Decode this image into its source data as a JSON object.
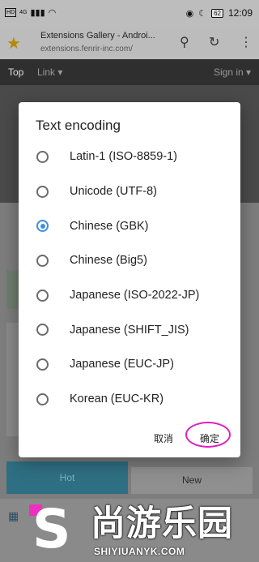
{
  "status_bar": {
    "left_badge": "HD",
    "signal_label": "4G",
    "battery": "62",
    "time": "12:09"
  },
  "browser": {
    "page_title": "Extensions Gallery - Androi...",
    "url": "extensions.fenrir-inc.com/"
  },
  "site_nav": {
    "top": "Top",
    "link": "Link ▾",
    "signin": "Sign in ▾"
  },
  "tabs": {
    "hot": "Hot",
    "new": "New"
  },
  "dialog": {
    "title": "Text encoding",
    "options": [
      {
        "label": "Latin-1 (ISO-8859-1)",
        "selected": false
      },
      {
        "label": "Unicode (UTF-8)",
        "selected": false
      },
      {
        "label": "Chinese (GBK)",
        "selected": true
      },
      {
        "label": "Chinese (Big5)",
        "selected": false
      },
      {
        "label": "Japanese (ISO-2022-JP)",
        "selected": false
      },
      {
        "label": "Japanese (SHIFT_JIS)",
        "selected": false
      },
      {
        "label": "Japanese (EUC-JP)",
        "selected": false
      },
      {
        "label": "Korean (EUC-KR)",
        "selected": false
      }
    ],
    "cancel_label": "取消",
    "ok_label": "确定"
  },
  "watermark": {
    "chinese": "尚游乐园",
    "english": "SHIYIUANYK.COM"
  },
  "colors": {
    "accent": "#3d8fe0",
    "highlight": "#e21fbf"
  }
}
